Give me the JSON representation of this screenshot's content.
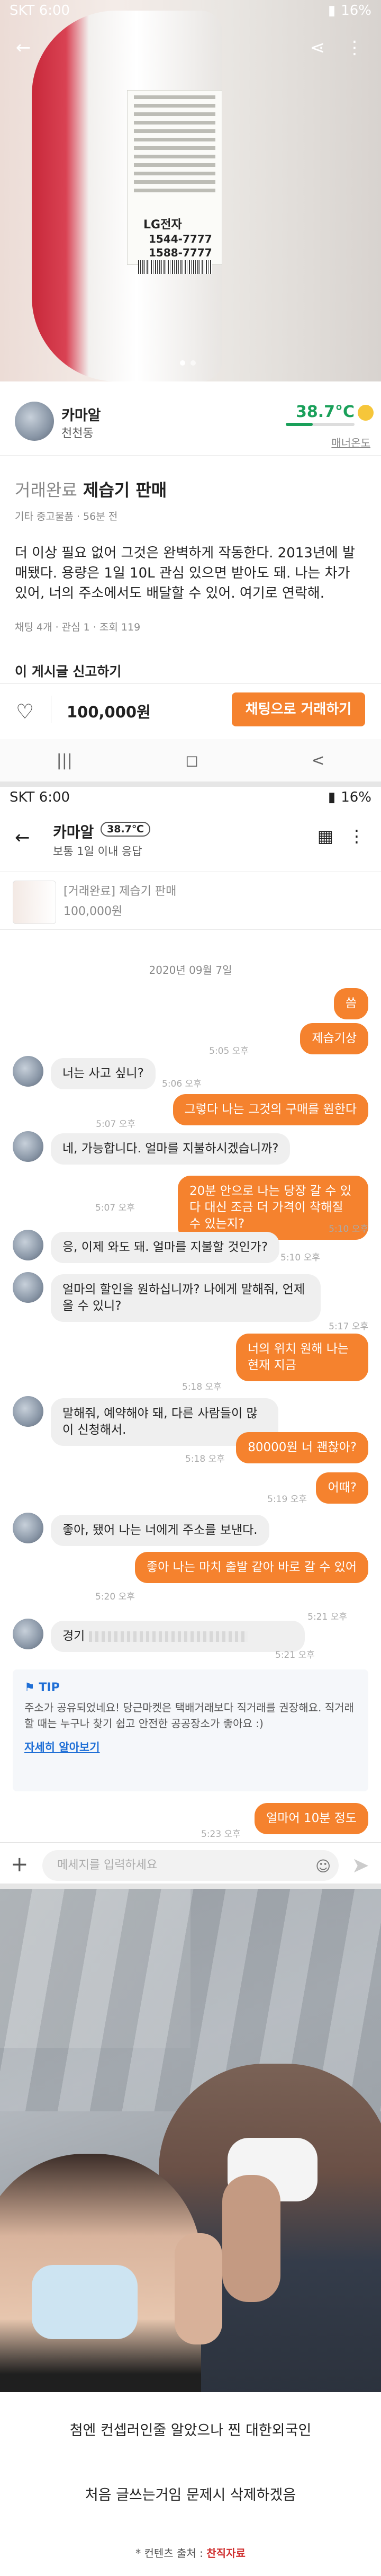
{
  "screen1": {
    "status": {
      "carrier": "SKT",
      "time": "6:00",
      "battery": "16%"
    },
    "seller": {
      "name": "카마알",
      "location": "천천동",
      "temperature": "38.7°C",
      "temperature_label": "매너온도",
      "temperature_level": 0.39
    },
    "post": {
      "status": "거래완료",
      "title": "제습기 판매",
      "meta": "기타 중고물품 · 56분 전",
      "body": "더 이상 필요 없어 그것은 완벽하게 작동한다. 2013년에 발매됐다. 용량은 1일 10L 관심 있으면 받아도 돼. 나는 차가 있어, 너의 주소에서도 배달할 수 있어. 여기로 연락해.",
      "counts": "채팅 4개 · 관심 1 · 조회 119"
    },
    "photo_label": {
      "brand": "LG전자",
      "phone1": "1544-7777",
      "phone2": "1588-7777"
    },
    "report_label": "이 게시글 신고하기",
    "price": "100,000원",
    "chat_button": "채팅으로 거래하기",
    "nav": {
      "recent": "|||",
      "home": "◻",
      "back": "<"
    }
  },
  "screen2": {
    "status": {
      "carrier": "SKT",
      "time": "6:00",
      "battery": "16%"
    },
    "header": {
      "name": "카마알",
      "temperature": "38.7℃",
      "subtitle": "보통 1일 이내 응답"
    },
    "product": {
      "title": "[거래완료] 제습기 판매",
      "price": "100,000원"
    },
    "date": "2020년 09월 7일",
    "messages": [
      {
        "side": "out",
        "text": "씀",
        "time": ""
      },
      {
        "side": "out",
        "text": "제습기상",
        "time": "5:05 오후"
      },
      {
        "side": "in",
        "text": "너는 사고 싶니?",
        "time": "5:06 오후"
      },
      {
        "side": "out",
        "text": "그렇다 나는 그것의 구매를 원한다",
        "time": "5:07 오후"
      },
      {
        "side": "in",
        "text": "네, 가능합니다. 얼마를 지불하시겠습니까?",
        "time": "5:07 오후"
      },
      {
        "side": "out",
        "text": "20분 안으로 나는 당장 갈 수 있다 대신 조금 더 가격이 착해질 수 있는지?",
        "time": "5:10 오후"
      },
      {
        "side": "in",
        "text": "응, 이제 와도 돼. 얼마를 지불할 것인가?",
        "time": "5:10 오후"
      },
      {
        "side": "in",
        "text": "얼마의 할인을 원하십니까? 나에게 말해줘, 언제 올 수 있니?",
        "time": "5:17 오후"
      },
      {
        "side": "out",
        "text": "너의 위치 원해 나는 현재 지금",
        "time": "5:18 오후"
      },
      {
        "side": "in",
        "text": "말해줘, 예약해야 돼, 다른 사람들이 많이 신청해서.",
        "time": "5:18 오후"
      },
      {
        "side": "out",
        "text": "80000원 너 괜찮아?",
        "time": "5:19 오후"
      },
      {
        "side": "out",
        "text": "어때?",
        "time": "5:19 오후"
      },
      {
        "side": "in",
        "text": "좋아, 됐어 나는 너에게 주소를 보낸다.",
        "time": "5:20 오후"
      },
      {
        "side": "out",
        "text": "좋아 나는 마치 출발 같아 바로 갈 수 있어",
        "time": "5:21 오후"
      },
      {
        "side": "in",
        "text": "경기",
        "time": "5:21 오후"
      },
      {
        "side": "out",
        "text": "얼마어 10분 정도",
        "time": "5:23 오후"
      }
    ],
    "tip": {
      "title": "TIP",
      "body": "주소가 공유되었네요! 당근마켓은 택배거래보다 직거래를 권장해요. 직거래할 때는 누구나 찾기 쉽고 안전한 공공장소가 좋아요 :)",
      "link": "자세히 알아보기"
    },
    "input_placeholder": "메세지를 입력하세요"
  },
  "screen3": {
    "caption1": "첨엔 컨셉러인줄 알았으나 찐 대한외국인",
    "caption2": "처음 글쓰는거임 문제시 삭제하겠음",
    "credit_prefix": "* 컨텐츠 출처 :",
    "credit_source": "찬직자료"
  },
  "colors": {
    "brand_orange": "#f5822e",
    "manner_green": "#1aa05a",
    "tip_blue": "#1f6fd6"
  }
}
